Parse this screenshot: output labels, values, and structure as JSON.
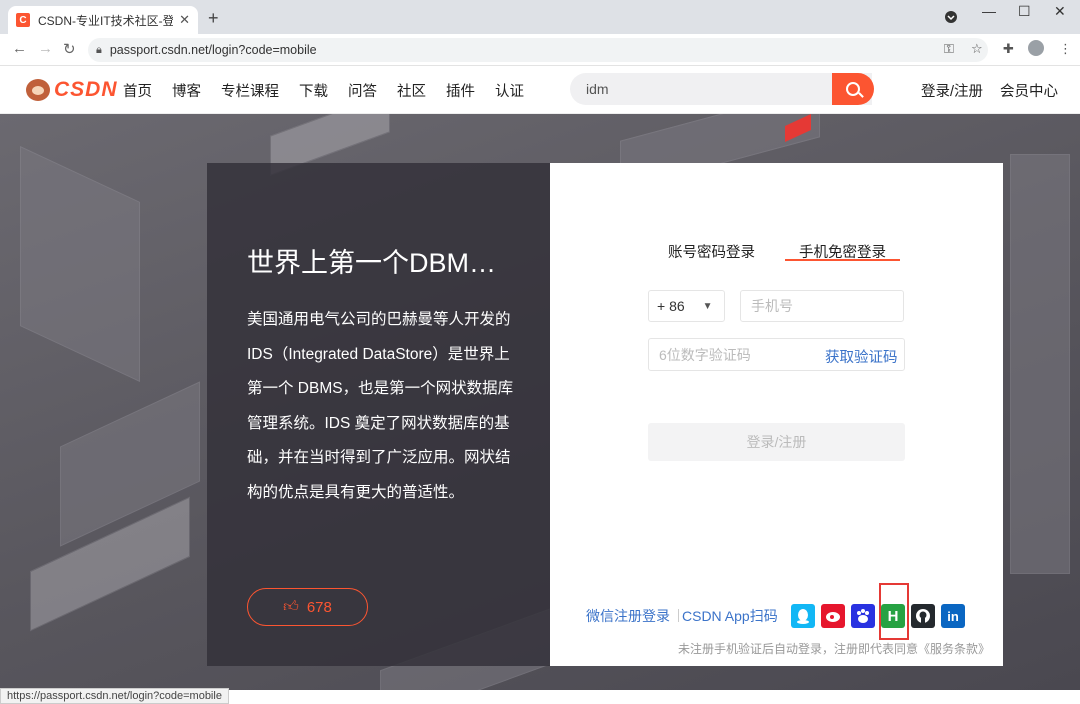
{
  "browser": {
    "tab_title": "CSDN-专业IT技术社区-登录",
    "favicon_letter": "C",
    "url": "passport.csdn.net/login?code=mobile",
    "status_url": "https://passport.csdn.net/login?code=mobile"
  },
  "header": {
    "logo_text": "CSDN",
    "nav": [
      "首页",
      "博客",
      "专栏课程",
      "下载",
      "问答",
      "社区",
      "插件",
      "认证"
    ],
    "search_value": "idm",
    "login_register": "登录/注册",
    "member_center": "会员中心"
  },
  "article": {
    "title": "世界上第一个DBM…",
    "body": "美国通用电气公司的巴赫曼等人开发的 IDS（Integrated DataStore）是世界上第一个 DBMS，也是第一个网状数据库管理系统。IDS 奠定了网状数据库的基础，并在当时得到了广泛应用。网状结构的优点是具有更大的普适性。",
    "likes": "678"
  },
  "login": {
    "tab_password": "账号密码登录",
    "tab_sms": "手机免密登录",
    "country_code": "+ 86",
    "phone_placeholder": "手机号",
    "code_placeholder": "6位数字验证码",
    "get_code": "获取验证码",
    "submit": "登录/注册",
    "wechat_register": "微信注册登录",
    "app_scan": "CSDN App扫码",
    "terms": "未注册手机验证后自动登录，注册即代表同意《服务条款》",
    "social_icons": [
      {
        "name": "qq-icon",
        "glyph": "Q",
        "color": "#12b7f5"
      },
      {
        "name": "weibo-icon",
        "glyph": "微",
        "color": "#e6162d"
      },
      {
        "name": "baidu-icon",
        "glyph": "百",
        "color": "#2932e1"
      },
      {
        "name": "huawei-h-icon",
        "glyph": "H",
        "color": "#27a243"
      },
      {
        "name": "github-icon",
        "glyph": "●",
        "color": "#24292e"
      },
      {
        "name": "linkedin-icon",
        "glyph": "in",
        "color": "#0a66c2"
      }
    ]
  },
  "colors": {
    "brand": "#fc5531",
    "link": "#3b73c9",
    "highlight_box": "#e53935"
  }
}
